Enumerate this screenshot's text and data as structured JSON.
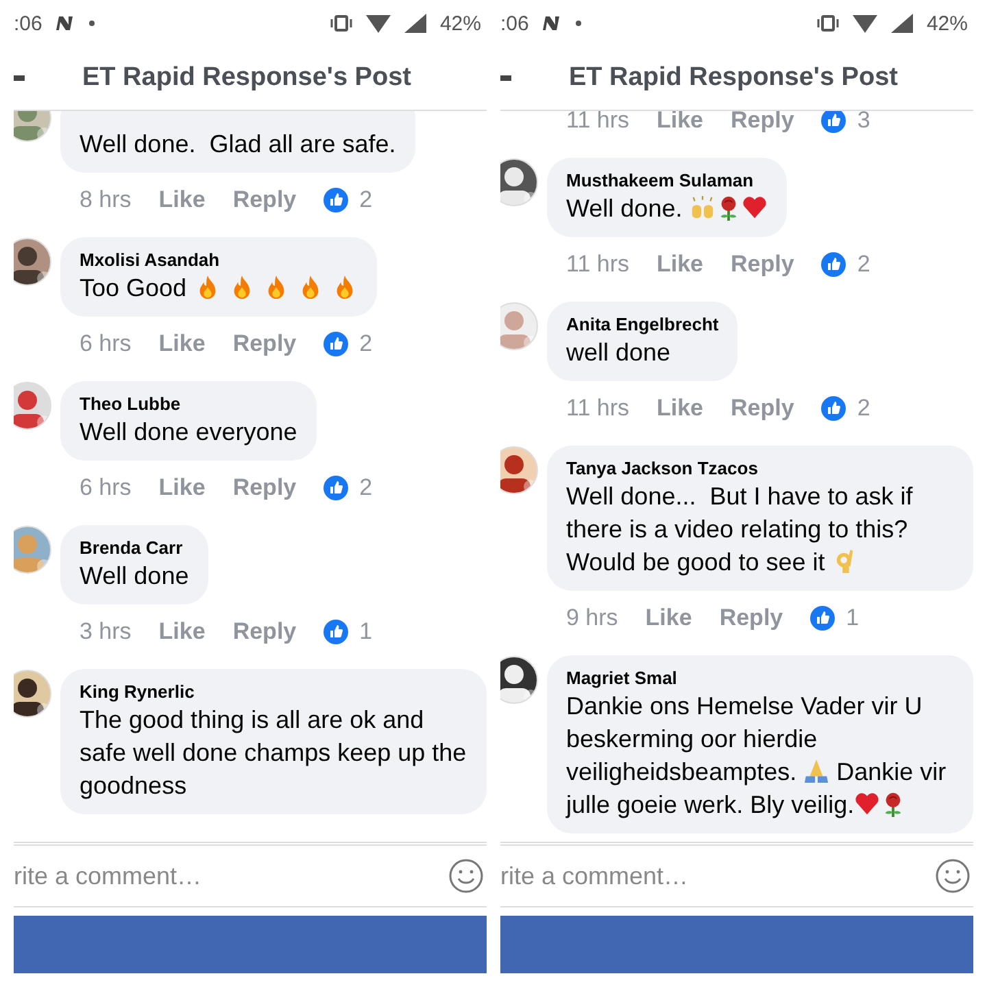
{
  "panels": [
    {
      "status_bar": {
        "time": ":06",
        "battery": "42%"
      },
      "header": {
        "title": "ET Rapid Response's Post"
      },
      "comments": [
        {
          "body": [
            {
              "kind": "text",
              "text": "Well done.  Glad all are safe."
            }
          ],
          "time": "8 hrs",
          "like": "Like",
          "reply": "Reply",
          "count": "2"
        },
        {
          "name": "Mxolisi Asandah",
          "body": [
            {
              "kind": "text",
              "text": "Too Good"
            },
            {
              "kind": "fire"
            },
            {
              "kind": "fire"
            },
            {
              "kind": "fire"
            },
            {
              "kind": "fire"
            },
            {
              "kind": "fire"
            }
          ],
          "time": "6 hrs",
          "like": "Like",
          "reply": "Reply",
          "count": "2"
        },
        {
          "name": "Theo Lubbe",
          "body": [
            {
              "kind": "text",
              "text": "Well done everyone"
            }
          ],
          "time": "6 hrs",
          "like": "Like",
          "reply": "Reply",
          "count": "2"
        },
        {
          "name": "Brenda Carr",
          "body": [
            {
              "kind": "text",
              "text": "Well done"
            }
          ],
          "time": "3 hrs",
          "like": "Like",
          "reply": "Reply",
          "count": "1"
        },
        {
          "name": "King Rynerlic",
          "body": [
            {
              "kind": "text",
              "text": "The good thing is all are ok and safe well done champs keep up the goodness"
            }
          ]
        }
      ],
      "comment_field": {
        "placeholder": "rite a comment…"
      }
    },
    {
      "status_bar": {
        "time": ":06",
        "battery": "42%"
      },
      "header": {
        "title": "ET Rapid Response's Post"
      },
      "comments": [
        {
          "time": "11 hrs",
          "like": "Like",
          "reply": "Reply",
          "count": "3"
        },
        {
          "name": "Musthakeem Sulaman",
          "body": [
            {
              "kind": "text",
              "text": "Well done. "
            },
            {
              "kind": "hands"
            },
            {
              "kind": "rose"
            },
            {
              "kind": "heart"
            }
          ],
          "time": "11 hrs",
          "like": "Like",
          "reply": "Reply",
          "count": "2"
        },
        {
          "name": "Anita Engelbrecht",
          "body": [
            {
              "kind": "text",
              "text": "well done"
            }
          ],
          "time": "11 hrs",
          "like": "Like",
          "reply": "Reply",
          "count": "2"
        },
        {
          "name": "Tanya Jackson Tzacos",
          "body": [
            {
              "kind": "text",
              "text": "Well done...  But I have to ask if there is a video relating to this? Would be good to see it "
            },
            {
              "kind": "ok"
            }
          ],
          "time": "9 hrs",
          "like": "Like",
          "reply": "Reply",
          "count": "1"
        },
        {
          "name": "Magriet Smal",
          "body": [
            {
              "kind": "text",
              "text": "Dankie ons Hemelse Vader vir U beskerming oor hierdie veiligheidsbeamptes. "
            },
            {
              "kind": "pray"
            },
            {
              "kind": "text",
              "text": " Dankie vir julle goeie werk. Bly veilig."
            },
            {
              "kind": "heart"
            },
            {
              "kind": "rose"
            }
          ]
        }
      ],
      "comment_field": {
        "placeholder": "rite a comment…"
      }
    }
  ]
}
